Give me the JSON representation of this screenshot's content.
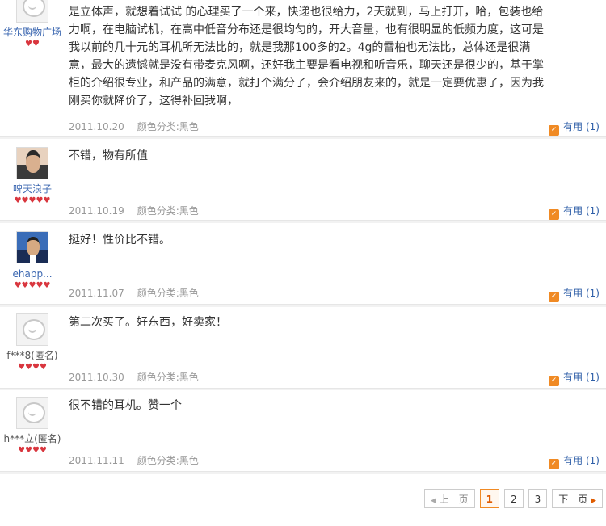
{
  "reviews": [
    {
      "user": "华东购物广场",
      "avatar": "default",
      "hearts": "♥♥",
      "text": "是立体声，就想着试试 的心理买了一个来，快递也很给力，2天就到，马上打开，哈，包装也给力啊，在电脑试机，在高中低音分布还是很均匀的，开大音量，也有很明显的低频力度，这可是我以前的几十元的耳机所无法比的，就是我那100多的2。4g的雷柏也无法比，总体还是很满意，最大的遗憾就是没有带麦克风啊，还好我主要是看电视和听音乐，聊天还是很少的，基于掌柜的介绍很专业，和产品的满意，就打个满分了，会介绍朋友来的，就是一定要优惠了，因为我刚买你就降价了，这得补回我啊，",
      "date": "2011.10.20",
      "category": "颜色分类:黑色",
      "useful": "有用 (1)"
    },
    {
      "user": "啤天浪子",
      "avatar": "photo1",
      "hearts": "♥♥♥♥♥",
      "text": "不错，物有所值",
      "date": "2011.10.19",
      "category": "颜色分类:黑色",
      "useful": "有用 (1)"
    },
    {
      "user": "ehapp...",
      "avatar": "photo2",
      "hearts": "♥♥♥♥♥",
      "text": "挺好！性价比不错。",
      "date": "2011.11.07",
      "category": "颜色分类:黑色",
      "useful": "有用 (1)"
    },
    {
      "user": "f***8(匿名)",
      "avatar": "default",
      "hearts": "♥♥♥♥",
      "text": "第二次买了。好东西，好卖家！",
      "date": "2011.10.30",
      "category": "颜色分类:黑色",
      "useful": "有用 (1)"
    },
    {
      "user": "h***立(匿名)",
      "avatar": "default",
      "hearts": "♥♥♥♥",
      "text": "很不错的耳机。赞一个",
      "date": "2011.11.11",
      "category": "颜色分类:黑色",
      "useful": "有用 (1)"
    }
  ],
  "pager": {
    "prev": "上一页",
    "pages": [
      "1",
      "2",
      "3"
    ],
    "current": "1",
    "next": "下一页"
  }
}
